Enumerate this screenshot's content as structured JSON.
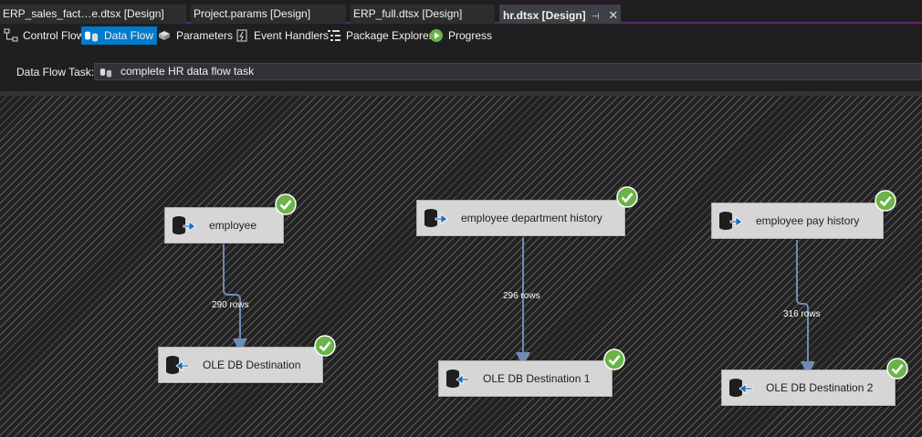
{
  "tabs": [
    {
      "label": "ERP_sales_fact…e.dtsx [Design]"
    },
    {
      "label": "Project.params [Design]"
    },
    {
      "label": "ERP_full.dtsx [Design]"
    },
    {
      "label": "hr.dtsx [Design]",
      "pin": "⊣",
      "close": "✕"
    }
  ],
  "toolbar": {
    "control_flow": "Control Flow",
    "data_flow": "Data Flow",
    "parameters": "Parameters",
    "event_handlers": "Event Handlers",
    "package_explorer": "Package Explorer",
    "progress": "Progress"
  },
  "task": {
    "label": "Data Flow Task:",
    "value": "complete HR data flow task"
  },
  "components": {
    "src1": "employee",
    "src2": "employee department history",
    "src3": "employee pay history",
    "dst1": "OLE DB Destination",
    "dst2": "OLE DB Destination 1",
    "dst3": "OLE DB Destination 2"
  },
  "paths": {
    "p1": "290 rows",
    "p2": "296 rows",
    "p3": "316 rows"
  },
  "colors": {
    "accent": "#007acc",
    "tab_accent": "#68217a",
    "success": "#6bb34a",
    "path": "#6f8bb5"
  }
}
